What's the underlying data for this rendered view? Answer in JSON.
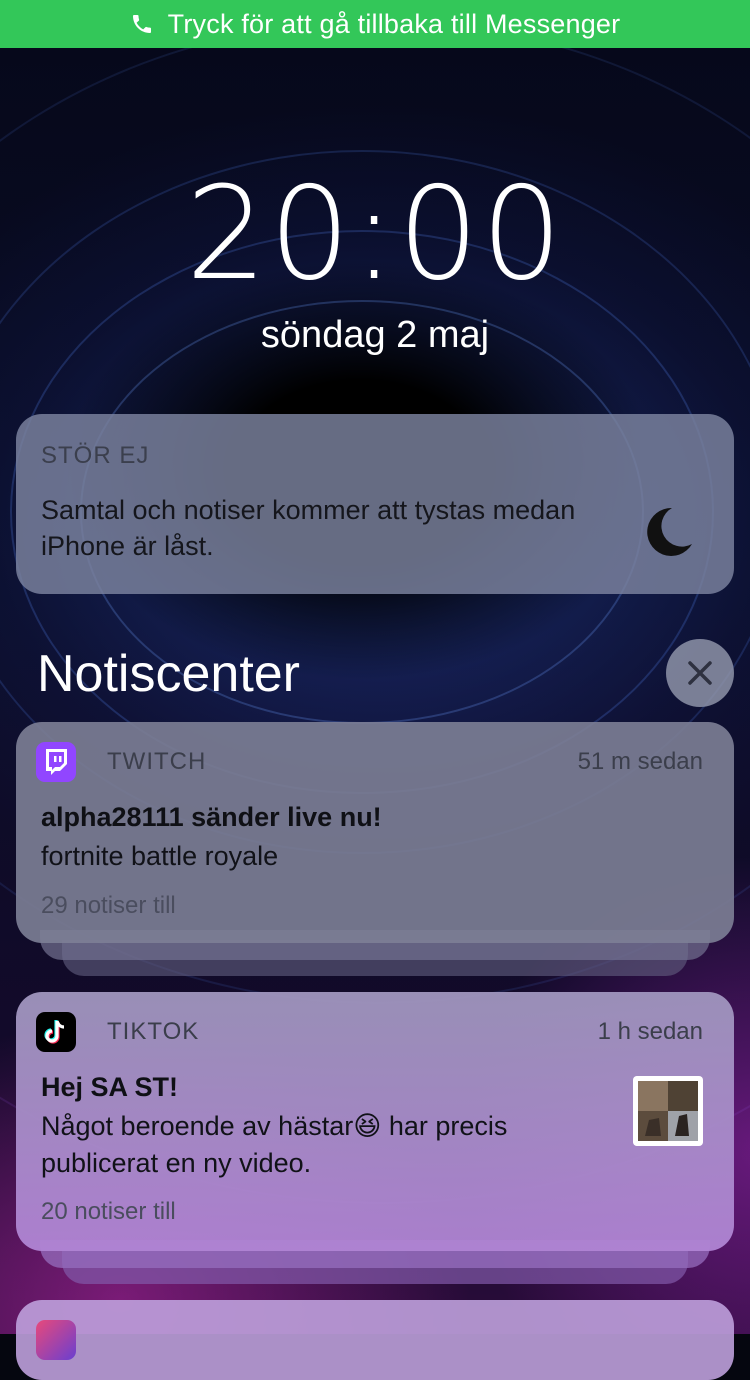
{
  "status_bar": {
    "text": "Tryck för att gå tillbaka till Messenger",
    "color": "#33c759"
  },
  "lock": {
    "time": "20:00",
    "date": "söndag 2 maj"
  },
  "dnd": {
    "title": "STÖR EJ",
    "body": "Samtal och notiser kommer att tystas medan iPhone är låst.",
    "icon": "moon-icon"
  },
  "notification_center": {
    "title": "Notiscenter",
    "close_icon": "close-icon"
  },
  "notifications": [
    {
      "app": "TWITCH",
      "time": "51 m sedan",
      "headline": "alpha28111 sänder live nu!",
      "message": "fortnite battle royale",
      "more": "29 notiser till",
      "icon": "twitch-icon",
      "icon_color": "#9146ff"
    },
    {
      "app": "TIKTOK",
      "time": "1 h sedan",
      "headline": "Hej SA ST!",
      "message_1": "Något beroende av hästar",
      "emoji": "😆",
      "message_2": " har precis publicerat en ny video.",
      "more": "20 notiser till",
      "icon": "tiktok-icon",
      "icon_color": "#000000"
    }
  ]
}
